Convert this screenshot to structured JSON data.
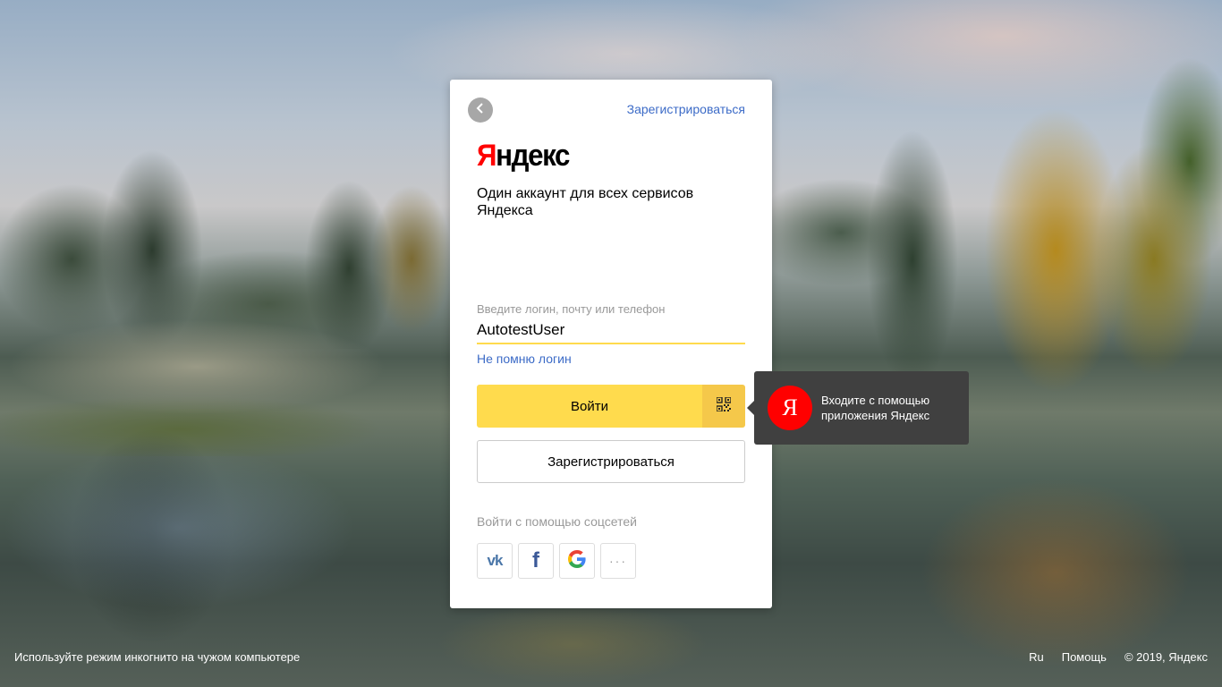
{
  "card": {
    "top_register_link": "Зарегистрироваться",
    "logo_first_letter": "Я",
    "logo_rest": "ндекс",
    "subtitle": "Один аккаунт для всех сервисов Яндекса",
    "login_label": "Введите логин, почту или телефон",
    "login_value": "AutotestUser",
    "forgot_link": "Не помню логин",
    "login_button": "Войти",
    "register_button": "Зарегистрироваться",
    "social_label": "Войти с помощью соцсетей",
    "social": [
      {
        "name": "vk",
        "label": "vk"
      },
      {
        "name": "facebook",
        "label": "f"
      },
      {
        "name": "google",
        "label": "G"
      },
      {
        "name": "more",
        "label": "···"
      }
    ]
  },
  "tooltip": {
    "icon_letter": "Я",
    "text": "Входите с помощью приложения Яндекс"
  },
  "footer": {
    "incognito_hint": "Используйте режим инкогнито на чужом компьютере",
    "language": "Ru",
    "help": "Помощь",
    "copyright": "© 2019, Яндекс"
  },
  "colors": {
    "accent_yellow": "#ffdb4d",
    "link_blue": "#3c6bc7",
    "brand_red": "#ff0000",
    "tooltip_bg": "#404040"
  }
}
